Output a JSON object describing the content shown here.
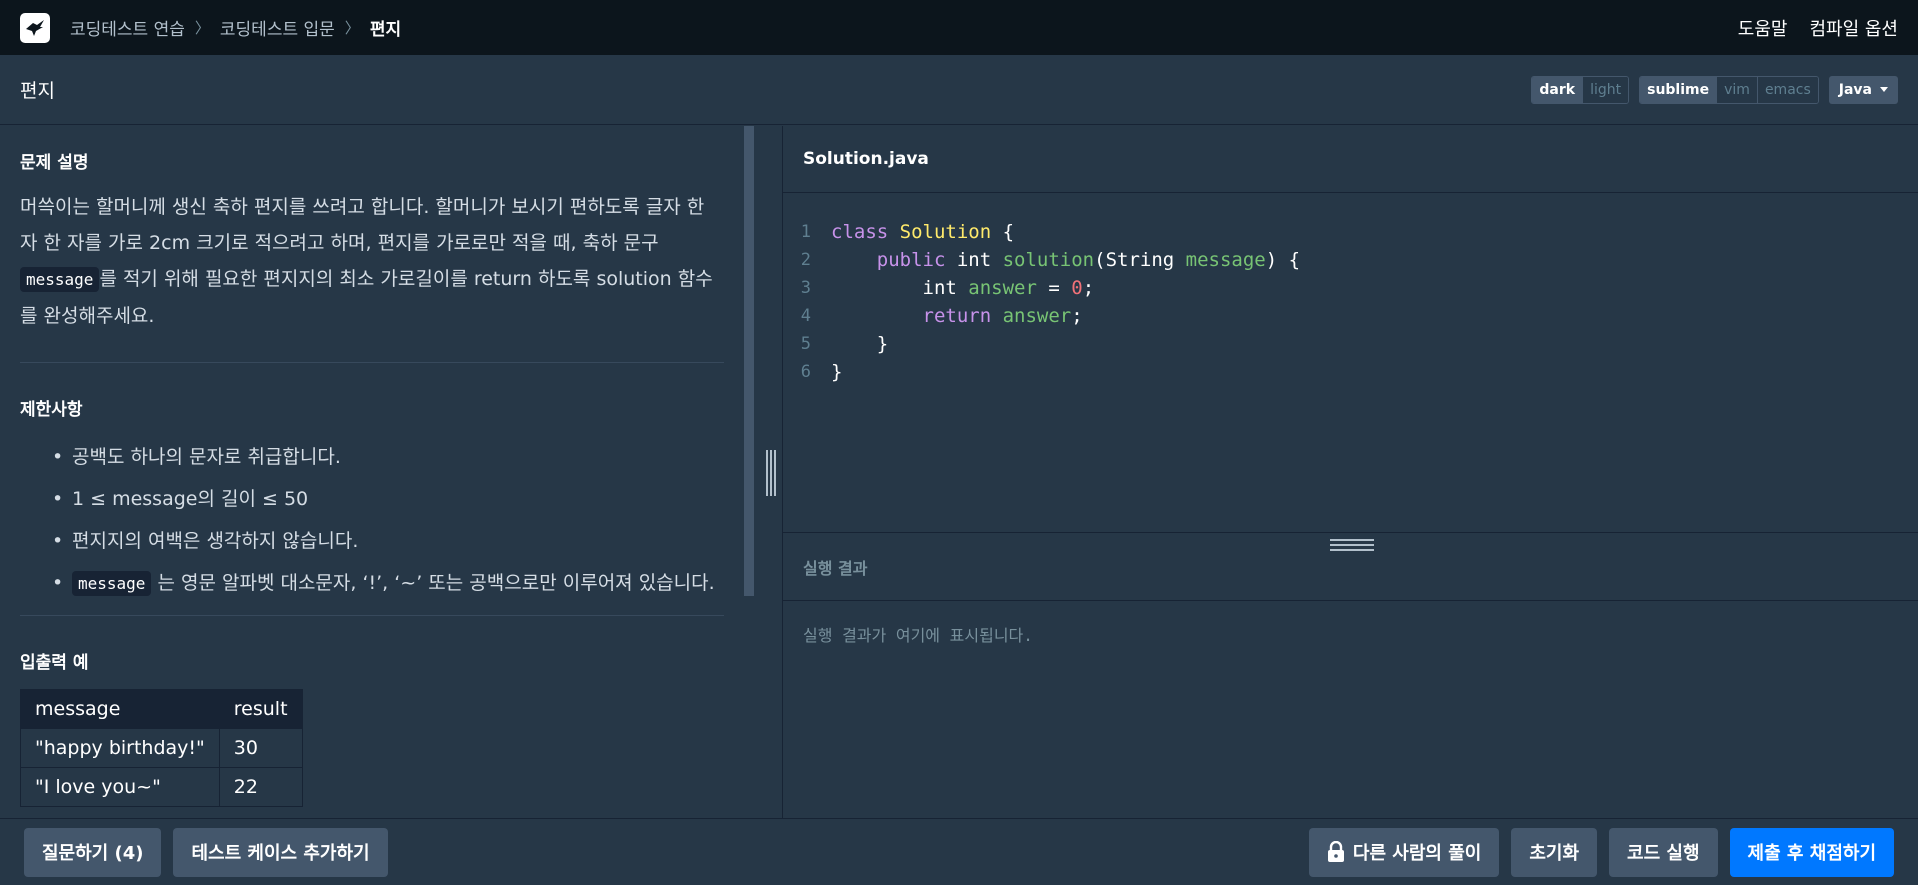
{
  "nav": {
    "breadcrumbs": [
      "코딩테스트 연습",
      "코딩테스트 입문"
    ],
    "current": "편지",
    "help": "도움말",
    "compile_options": "컴파일 옵션"
  },
  "titlebar": {
    "title": "편지",
    "theme_options": [
      "dark",
      "light"
    ],
    "theme_selected": "dark",
    "keymap_options": [
      "sublime",
      "vim",
      "emacs"
    ],
    "keymap_selected": "sublime",
    "language": "Java"
  },
  "problem": {
    "desc_heading": "문제 설명",
    "desc_part1": "머쓱이는 할머니께 생신 축하 편지를 쓰려고 합니다. 할머니가 보시기 편하도록 글자 한 자 한 자를 가로 2cm 크기로 적으려고 하며, 편지를 가로로만 적을 때, 축하 문구 ",
    "desc_code": "message",
    "desc_part2": "를 적기 위해 필요한 편지지의 최소 가로길이를 return 하도록 solution 함수를 완성해주세요.",
    "limits_heading": "제한사항",
    "limits": [
      "공백도 하나의 문자로 취급합니다.",
      "1 ≤ message의 길이 ≤ 50",
      "편지지의 여백은 생각하지 않습니다."
    ],
    "limit4_code": "message",
    "limit4_text": " 는 영문 알파벳 대소문자, ‘!’, ‘~’ 또는 공백으로만 이루어져 있습니다.",
    "io_heading": "입출력 예",
    "io_headers": [
      "message",
      "result"
    ],
    "io_rows": [
      [
        "\"happy birthday!\"",
        "30"
      ],
      [
        "\"I love you~\"",
        "22"
      ]
    ]
  },
  "editor": {
    "filename": "Solution.java",
    "line_numbers": [
      "1",
      "2",
      "3",
      "4",
      "5",
      "6"
    ],
    "code": {
      "l1_kw": "class",
      "l1_cls": "Solution",
      "l1_rest": " {",
      "l2_kw": "public",
      "l2_type": " int ",
      "l2_fn": "solution",
      "l2_open": "(String ",
      "l2_param": "message",
      "l2_close": ") {",
      "l3_type": "int ",
      "l3_var": "answer",
      "l3_eq": " = ",
      "l3_num": "0",
      "l3_end": ";",
      "l4_kw": "return",
      "l4_var": "answer",
      "l4_end": ";",
      "l5": "}",
      "l6": "}"
    }
  },
  "result": {
    "heading": "실행 결과",
    "placeholder": "실행 결과가 여기에 표시됩니다."
  },
  "bottom": {
    "question": "질문하기 (4)",
    "add_testcase": "테스트 케이스 추가하기",
    "others_solution": "다른 사람의 풀이",
    "reset": "초기화",
    "run": "코드 실행",
    "submit": "제출 후 채점하기"
  }
}
